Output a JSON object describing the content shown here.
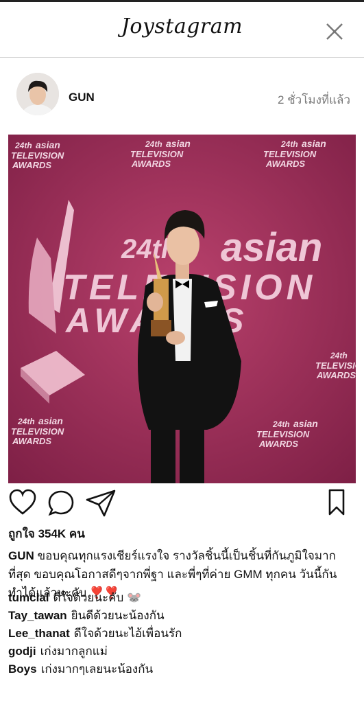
{
  "app": {
    "title": "Joystagram"
  },
  "post": {
    "username": "GUN",
    "time": "2 ชั่วโมงที่แล้ว",
    "likes": "ถูกใจ 354K คน",
    "caption": "ขอบคุณทุกแรงเชียร์แรงใจ รางวัลชิ้นนี้เป็นชิ้นที่กันภูมิใจมากที่สุด ขอบคุณโอกาสดีๆจากพี่ฐา และพี่ๆที่ค่าย GMM ทุกคน วันนี้กันทำได้แล้วนะคับ ❣️❣️",
    "photo_text": {
      "number": "24th",
      "brand": "asian",
      "line1": "TELEVISION",
      "line2": "AWARDS"
    }
  },
  "comments": [
    {
      "user": "tumcial",
      "text": "ดีใจด้วยนะคับ 🐭"
    },
    {
      "user": "Tay_tawan",
      "text": "ยินดีด้วยนะน้องกัน"
    },
    {
      "user": "Lee_thanat",
      "text": "ดีใจด้วยนะไอ้เพื่อนรัก"
    },
    {
      "user": "godji",
      "text": "เก่งมากลูกแม่"
    },
    {
      "user": "Boys",
      "text": "เก่งมากๆเลยนะน้องกัน"
    }
  ],
  "icons": {
    "close": "close-icon",
    "like": "heart-icon",
    "comment": "comment-bubble-icon",
    "share": "paper-plane-icon",
    "save": "bookmark-icon"
  },
  "colors": {
    "backdrop": "#a8355f",
    "accent_text": "#f2d7e3"
  }
}
